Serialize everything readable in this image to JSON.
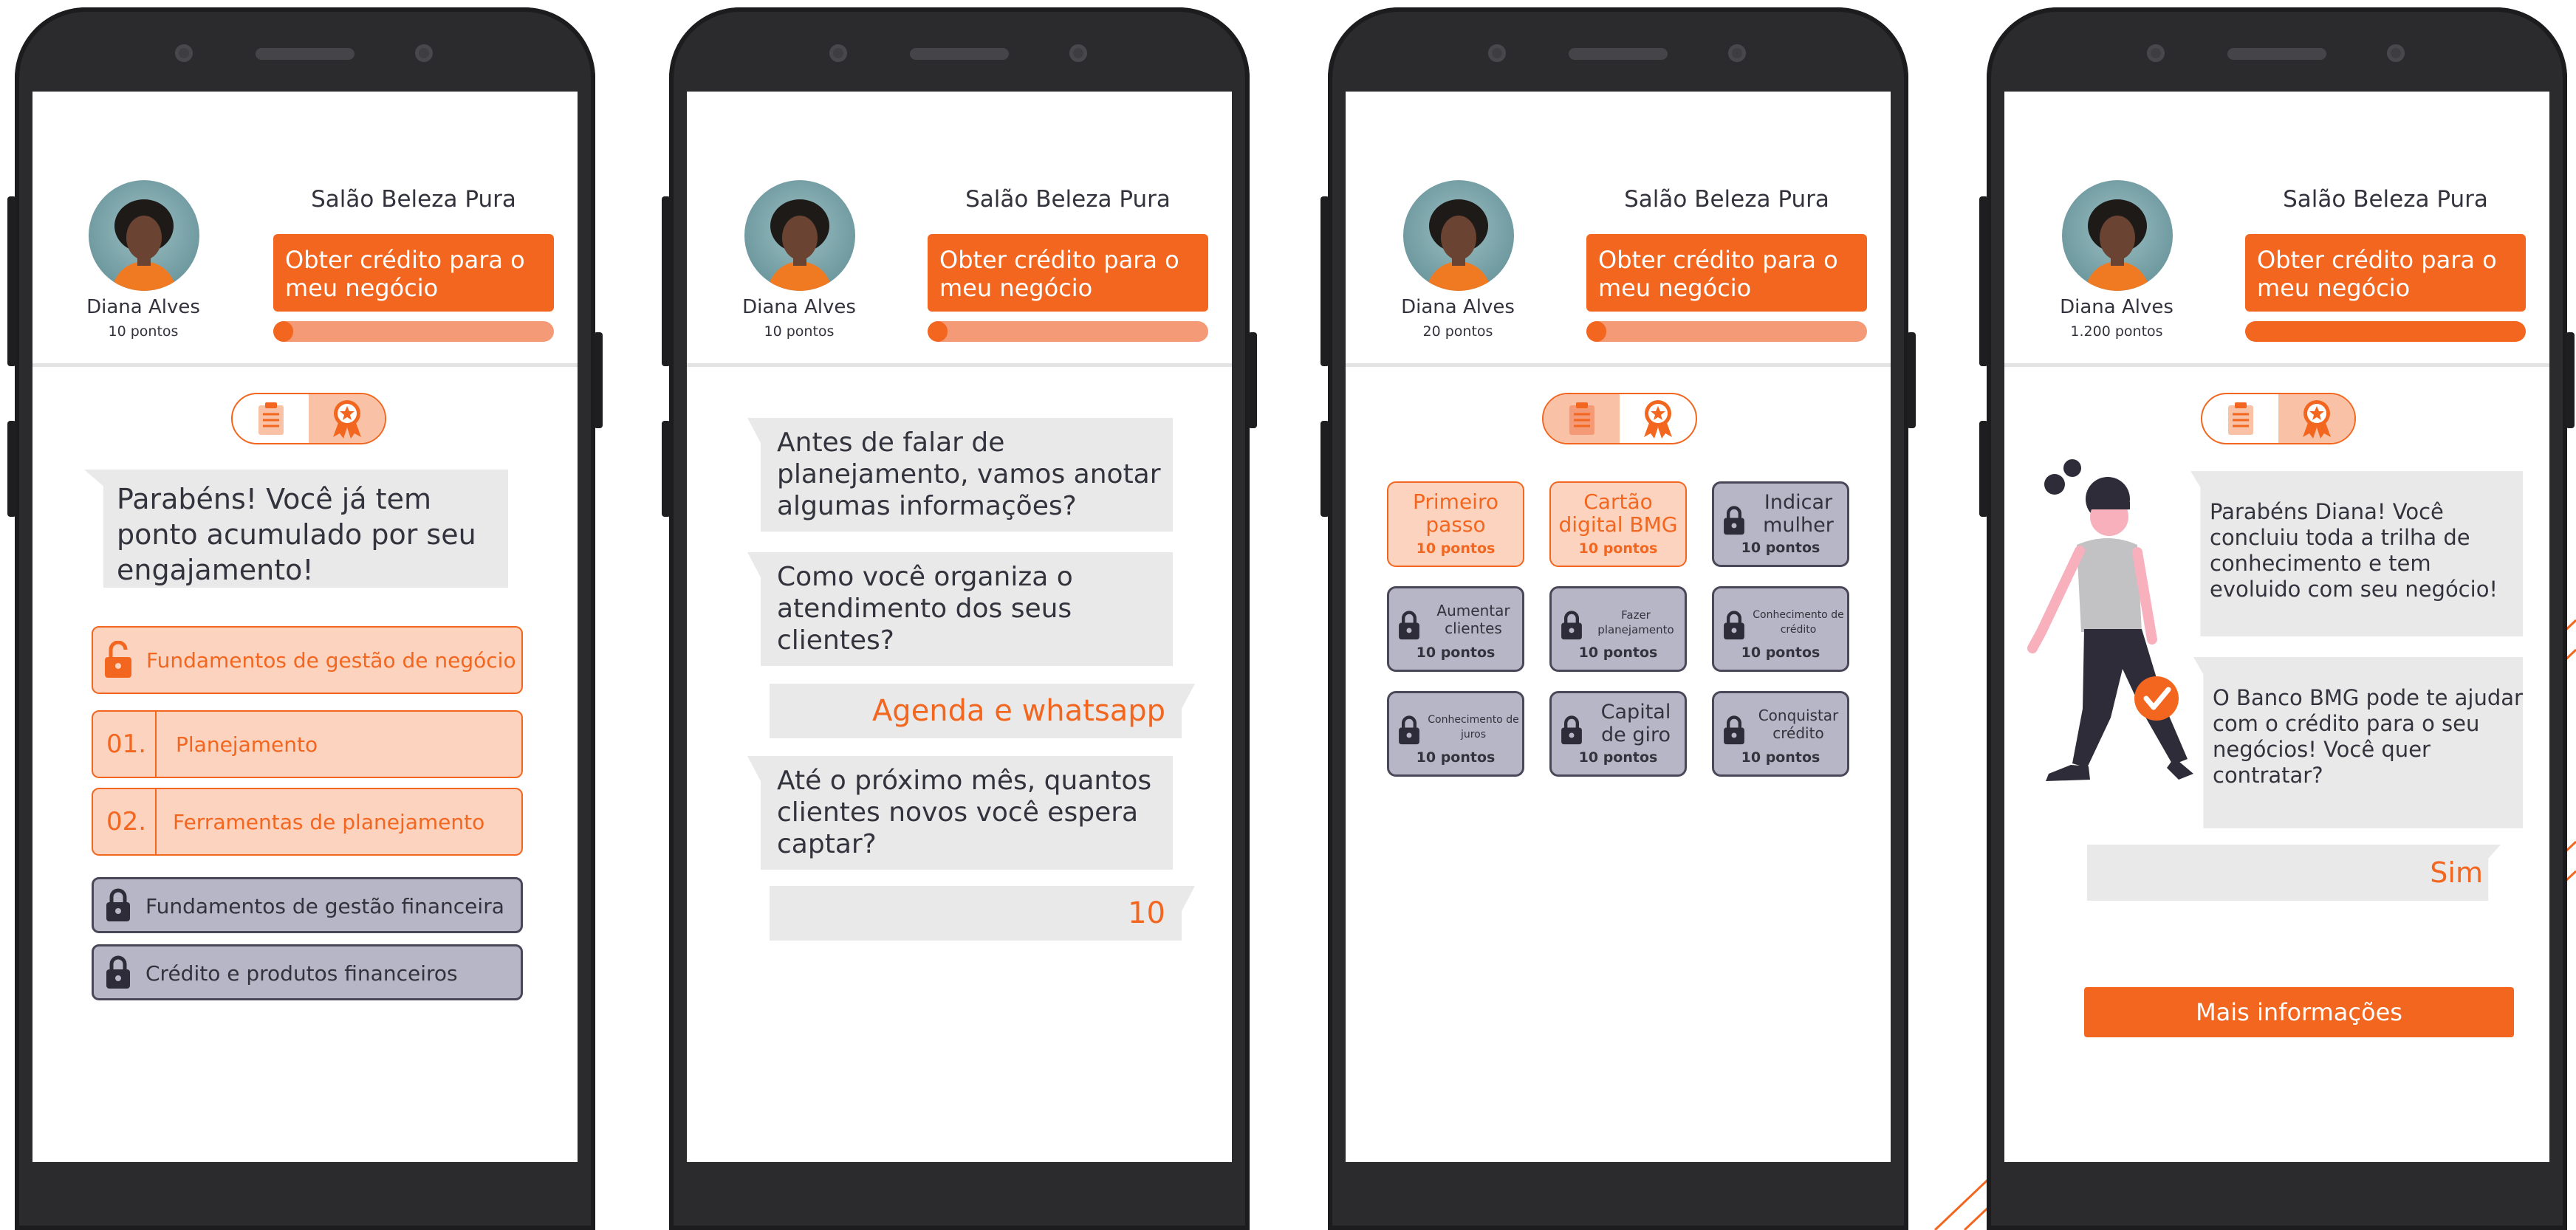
{
  "theme": {
    "accent": "#f2661f",
    "accent_light": "#fcd3bf",
    "locked": "#b7b6c6",
    "bubble": "#e9e9e9"
  },
  "phones": [
    {
      "salon": "Salão Beleza Pura",
      "user_name": "Diana Alves",
      "points": "10 pontos",
      "credit_button": "Obter crédito para o meu negócio",
      "progress": 0.05,
      "tabs": [
        "clipboard-icon",
        "award-icon"
      ],
      "active_tab": "award",
      "message": "Parabéns! Você já tem ponto acumulado por seu engajamento!",
      "modules": [
        {
          "label": "Fundamentos de gestão de negócio",
          "state": "unlocked"
        },
        {
          "number": "01.",
          "label": "Planejamento"
        },
        {
          "number": "02.",
          "label": "Ferramentas de planejamento"
        },
        {
          "label": "Fundamentos de gestão financeira",
          "state": "locked"
        },
        {
          "label": "Crédito e produtos financeiros",
          "state": "locked"
        }
      ]
    },
    {
      "salon": "Salão Beleza Pura",
      "user_name": "Diana Alves",
      "points": "10 pontos",
      "credit_button": "Obter crédito para o meu negócio",
      "progress": 0.05,
      "chat": [
        {
          "from": "bot",
          "text": "Antes de falar de planejamento, vamos anotar algumas informações?"
        },
        {
          "from": "bot",
          "text": "Como você organiza o atendimento dos seus clientes?"
        },
        {
          "from": "user",
          "text": "Agenda e whatsapp"
        },
        {
          "from": "bot",
          "text": "Até o próximo mês, quantos clientes novos você espera captar?"
        },
        {
          "from": "user",
          "text": "10"
        }
      ]
    },
    {
      "salon": "Salão Beleza Pura",
      "user_name": "Diana Alves",
      "points": "20 pontos",
      "credit_button": "Obter crédito para o meu negócio",
      "progress": 0.05,
      "active_tab": "clipboard",
      "achievements": [
        {
          "title": "Primeiro passo",
          "points": "10 pontos",
          "state": "done"
        },
        {
          "title": "Cartão digital BMG",
          "points": "10 pontos",
          "state": "done"
        },
        {
          "title": "Indicar mulher",
          "points": "10 pontos",
          "state": "locked"
        },
        {
          "title": "Aumentar clientes",
          "points": "10 pontos",
          "state": "locked"
        },
        {
          "title": "Fazer planejamento",
          "points": "10 pontos",
          "state": "locked"
        },
        {
          "title": "Conhecimento de crédito",
          "points": "10 pontos",
          "state": "locked"
        },
        {
          "title": "Conhecimento de juros",
          "points": "10 pontos",
          "state": "locked"
        },
        {
          "title": "Capital de giro",
          "points": "10 pontos",
          "state": "locked"
        },
        {
          "title": "Conquistar crédito",
          "points": "10 pontos",
          "state": "locked"
        }
      ]
    },
    {
      "salon": "Salão Beleza Pura",
      "user_name": "Diana Alves",
      "points": "1.200 pontos",
      "credit_button": "Obter crédito para o meu negócio",
      "progress": 1.0,
      "active_tab": "award",
      "message1": "Parabéns Diana! Você concluiu toda a trilha de conhecimento e tem evoluido com seu negócio!",
      "message2": "O Banco BMG pode te ajudar com o crédito para o seu negócios! Você quer contratar?",
      "answer": "Sim",
      "more_button": "Mais informações"
    }
  ]
}
